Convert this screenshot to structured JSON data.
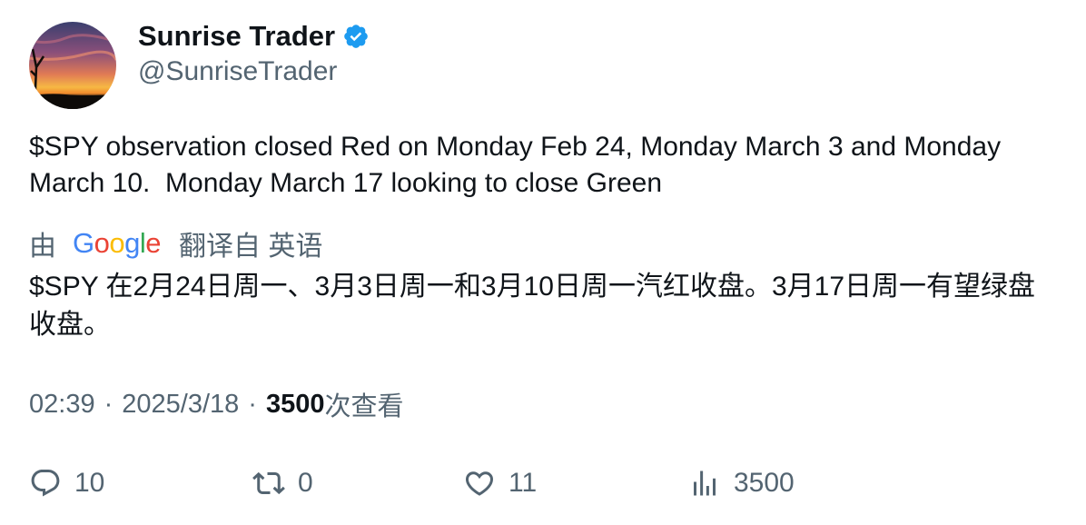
{
  "author": {
    "display_name": "Sunrise Trader",
    "handle": "@SunriseTrader",
    "verified": true,
    "verified_color": "#1d9bf0"
  },
  "tweet": {
    "text": "$SPY observation closed Red on Monday Feb 24, Monday March 3 and Monday March 10.  Monday March 17 looking to close Green"
  },
  "translation": {
    "by_label": "由",
    "provider": "Google",
    "from_label": "翻译自 英语",
    "text": "$SPY 在2月24日周一、3月3日周一和3月10日周一汽红收盘。3月17日周一有望绿盘收盘。"
  },
  "meta": {
    "time": "02:39",
    "separator": "·",
    "date": "2025/3/18",
    "views_count": "3500",
    "views_label": "次查看"
  },
  "actions": {
    "replies": "10",
    "retweets": "0",
    "likes": "11",
    "views": "3500"
  },
  "colors": {
    "text_primary": "#0f1419",
    "text_secondary": "#536471",
    "google_blue": "#4285F4",
    "google_red": "#EA4335",
    "google_yellow": "#FBBC05",
    "google_green": "#34A853"
  }
}
